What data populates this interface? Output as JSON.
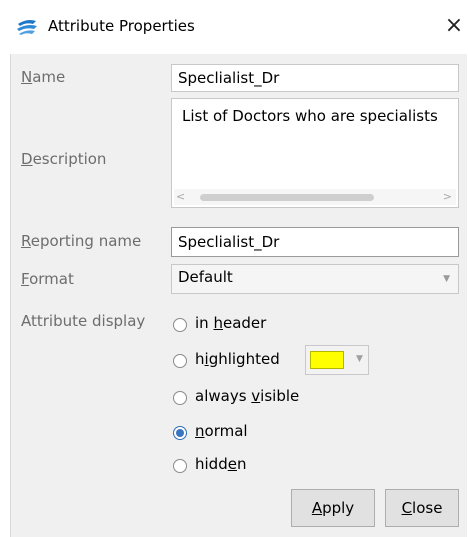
{
  "window": {
    "title": "Attribute Properties",
    "close_glyph": "×",
    "icon": "app-logo-icon"
  },
  "fields": {
    "name": {
      "label": "Name",
      "value": "Speclialist_Dr"
    },
    "description": {
      "label": "Description",
      "value": "List of Doctors who are specialists"
    },
    "reporting_name": {
      "label": "Reporting name",
      "value": "Speclialist_Dr"
    },
    "format": {
      "label": "Format",
      "value": "Default"
    }
  },
  "attribute_display": {
    "label": "Attribute display",
    "options": [
      {
        "label": "in header",
        "checked": false
      },
      {
        "label": "highlighted",
        "checked": false
      },
      {
        "label": "always visible",
        "checked": false
      },
      {
        "label": "normal",
        "checked": true
      },
      {
        "label": "hidden",
        "checked": false
      }
    ],
    "highlight_color": "#ffff00"
  },
  "buttons": {
    "apply": "Apply",
    "close": "Close"
  }
}
